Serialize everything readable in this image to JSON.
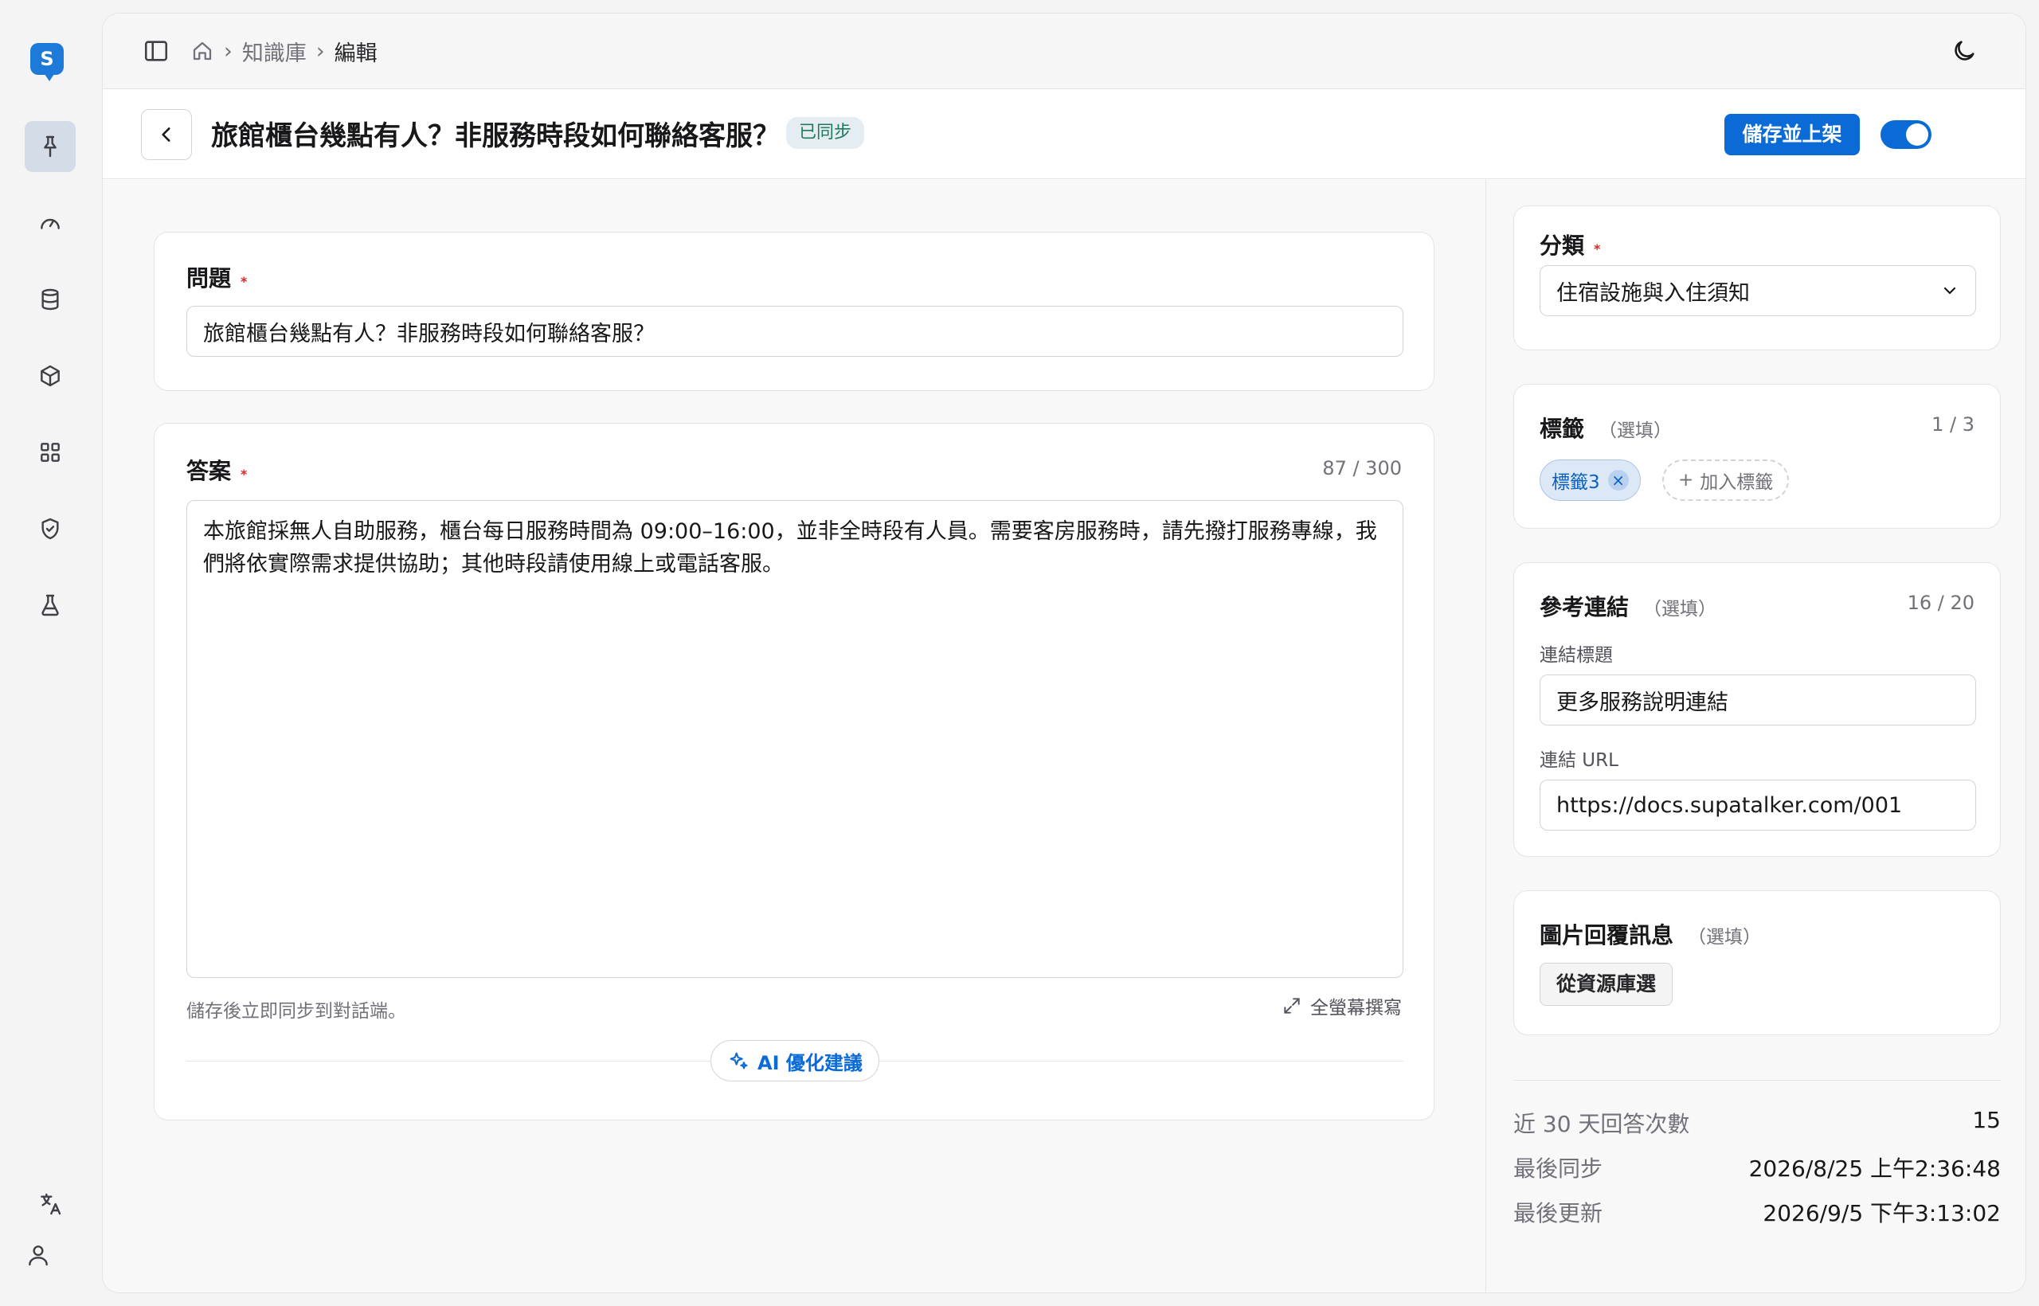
{
  "rail": {
    "logo": "S",
    "items": [
      "pin-icon",
      "gauge-icon",
      "database-icon",
      "package-icon",
      "apps-grid-icon",
      "shield-check-icon",
      "flask-icon"
    ],
    "bottom": [
      "translate-icon",
      "user-icon"
    ]
  },
  "breadcrumb": {
    "home": "home-icon",
    "items": [
      "知識庫",
      "編輯"
    ]
  },
  "header": {
    "title": "旅館櫃台幾點有人？非服務時段如何聯絡客服？",
    "status": "已同步",
    "publish_label": "儲存並上架",
    "enabled": true
  },
  "question": {
    "label": "問題",
    "required": "*",
    "value": "旅館櫃台幾點有人？非服務時段如何聯絡客服？"
  },
  "answer": {
    "label": "答案",
    "required": "*",
    "count": "87 / 300",
    "value": "本旅館採無人自助服務，櫃台每日服務時間為 09:00–16:00，並非全時段有人員。需要客房服務時，請先撥打服務專線，我們將依實際需求提供協助；其他時段請使用線上或電話客服。",
    "hint": "儲存後立即同步到對話端。",
    "fullscreen_label": "全螢幕撰寫",
    "ai_label": "AI 優化建議"
  },
  "category": {
    "label": "分類",
    "required": "*",
    "value": "住宿設施與入住須知"
  },
  "tags": {
    "label": "標籤",
    "optional": "（選填）",
    "count": "1 / 3",
    "items": [
      "標籤3"
    ],
    "add_label": "加入標籤"
  },
  "links": {
    "label": "參考連結",
    "optional": "（選填）",
    "count": "16 / 20",
    "title_label": "連結標題",
    "title_value": "更多服務說明連結",
    "url_label": "連結 URL",
    "url_value": "https://docs.supatalker.com/001"
  },
  "image_reply": {
    "label": "圖片回覆訊息",
    "optional": "（選填）",
    "button_label": "從資源庫選"
  },
  "stats": [
    {
      "key": "近 30 天回答次數",
      "value": "15"
    },
    {
      "key": "最後同步",
      "value": "2026/8/25 上午2:36:48"
    },
    {
      "key": "最後更新",
      "value": "2026/9/5 下午3:13:02"
    }
  ],
  "colors": {
    "accent": "#0a6ad6",
    "required": "#dc2626",
    "synced": "#1f7a5c"
  }
}
